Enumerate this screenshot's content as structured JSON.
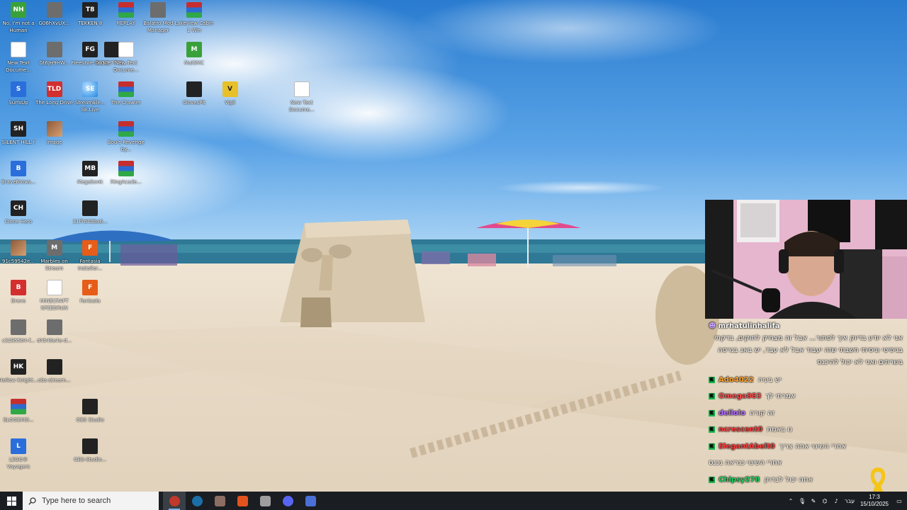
{
  "desktop": {
    "icons": [
      {
        "label": "No, I'm not a Human",
        "abbr": "NH",
        "style": "g-green"
      },
      {
        "label": "New Text Docume...",
        "abbr": "",
        "style": "g-doc"
      },
      {
        "label": "SurfsUp",
        "abbr": "S",
        "style": "g-blue"
      },
      {
        "label": "SILENT HILL f",
        "abbr": "SH",
        "style": "g-dark"
      },
      {
        "label": "BraveBrows...",
        "abbr": "B",
        "style": "g-blue"
      },
      {
        "label": "Clone Hero",
        "abbr": "CH",
        "style": "g-dark"
      },
      {
        "label": "91c59542e...",
        "abbr": "",
        "style": "g-photo"
      },
      {
        "label": "Brave",
        "abbr": "B",
        "style": "g-red"
      },
      {
        "label": "c3295564-f...",
        "abbr": "",
        "style": "g-gray"
      },
      {
        "label": "Hollow Knight...",
        "abbr": "HK",
        "style": "g-dark"
      },
      {
        "label": "BLOODMO...",
        "abbr": "",
        "style": "g-winrar"
      },
      {
        "label": "LEGO® Voyagers",
        "abbr": "L",
        "style": "g-blue"
      },
      {
        "label": "G06hXvUX...",
        "abbr": "",
        "style": "g-gray"
      },
      {
        "label": "Gt6JH9HW...",
        "abbr": "",
        "style": "g-gray"
      },
      {
        "label": "The Long Drive",
        "abbr": "TLD",
        "style": "g-red"
      },
      {
        "label": "image",
        "abbr": "",
        "style": "g-photo"
      },
      {
        "label": "Marbles on Stream",
        "abbr": "M",
        "style": "g-gray"
      },
      {
        "label": "MINECRAFT SPEEDRUN",
        "abbr": "",
        "style": "g-doc"
      },
      {
        "label": "d4546e4e-d...",
        "abbr": "",
        "style": "g-gray"
      },
      {
        "label": "obs-stream...",
        "abbr": "",
        "style": "g-dark"
      },
      {
        "label": "TEKKEN 8",
        "abbr": "T8",
        "style": "g-dark"
      },
      {
        "label": "Freestyle GunZ",
        "abbr": "FG",
        "style": "g-dark"
      },
      {
        "label": "StreamEle... SE.Live",
        "abbr": "SE",
        "style": "g-edge"
      },
      {
        "label": "Megabonk",
        "abbr": "MB",
        "style": "g-dark"
      },
      {
        "label": "31f7d40ba6...",
        "abbr": "",
        "style": "g-dark"
      },
      {
        "label": "Fantasia Installer...",
        "abbr": "F",
        "style": "g-orange"
      },
      {
        "label": "Fantasia",
        "abbr": "F",
        "style": "g-orange"
      },
      {
        "label": "OBS Studio",
        "abbr": "",
        "style": "g-dark g-round"
      },
      {
        "label": "OBS-Studio...",
        "abbr": "",
        "style": "g-dark g-round"
      },
      {
        "label": "0d3ce7746...",
        "abbr": "",
        "style": "g-dark"
      },
      {
        "label": "REPLAY",
        "abbr": "",
        "style": "g-winrar"
      },
      {
        "label": "Balatro Mod Manager",
        "abbr": "",
        "style": "g-gray"
      },
      {
        "label": "New Text Docume...",
        "abbr": "",
        "style": "g-doc"
      },
      {
        "label": "The Crawler",
        "abbr": "",
        "style": "g-winrar"
      },
      {
        "label": "Bou's Revenge by...",
        "abbr": "",
        "style": "g-winrar"
      },
      {
        "label": "RingAcade...",
        "abbr": "",
        "style": "g-winrar"
      },
      {
        "label": "Lakeview Cabin 1 Win",
        "abbr": "",
        "style": "g-winrar"
      },
      {
        "label": "MultiMC",
        "abbr": "M",
        "style": "g-green"
      },
      {
        "label": "ClovesPit",
        "abbr": "",
        "style": "g-dark"
      },
      {
        "label": "Vigil",
        "abbr": "V",
        "style": "g-yellow"
      },
      {
        "label": "New Text Docume...",
        "abbr": "",
        "style": "g-doc"
      }
    ]
  },
  "chat": {
    "first": {
      "username": "mrhatulinhalifa",
      "message": "אני לא יודע בדיוק איך לפתור... אבל זה מצחיק לחוקים, בדקתי בגיפיטי וניסיתי חשבתי שזה יעבוד אבל לא עבד, יש באג בגרסה בשרתים ואני לא יכול להיכנס"
    },
    "lines": [
      {
        "username": "Ado4022",
        "color": "#ffa32b",
        "message": "יש בעיה"
      },
      {
        "username": "Omega883",
        "color": "#ff4d4d",
        "message": "אמרתי לך"
      },
      {
        "username": "dellolo",
        "color": "#b36bff",
        "message": "זה קורה"
      },
      {
        "username": "ncrescent0",
        "color": "#ff3b3b",
        "message": "נו באמת"
      },
      {
        "username": "ElegantAbelt0",
        "color": "#ff3b3b",
        "message": "אחרי השינוי אתה צריך"
      },
      {
        "username": "",
        "color": "#ffffff",
        "message": "אחרי השינוי כנראה נכנס"
      },
      {
        "username": "Chipsy278",
        "color": "#1fd65f",
        "message": "אתה יכול לבדוק"
      }
    ]
  },
  "taskbar": {
    "search_placeholder": "Type here to search",
    "apps": [
      {
        "name": "obs",
        "color": "#c0392b",
        "active": true
      },
      {
        "name": "steam",
        "color": "#1b6fa8",
        "active": false
      },
      {
        "name": "files",
        "color": "#8d6e63",
        "active": false
      },
      {
        "name": "brave",
        "color": "#e3531d",
        "active": false
      },
      {
        "name": "app5",
        "color": "#9e9e9e",
        "active": false
      },
      {
        "name": "discord",
        "color": "#5865f2",
        "active": false
      },
      {
        "name": "app7",
        "color": "#4a6fd6",
        "active": false
      }
    ],
    "language": "עבר",
    "time": "17:3",
    "date": "15/10/2025"
  }
}
